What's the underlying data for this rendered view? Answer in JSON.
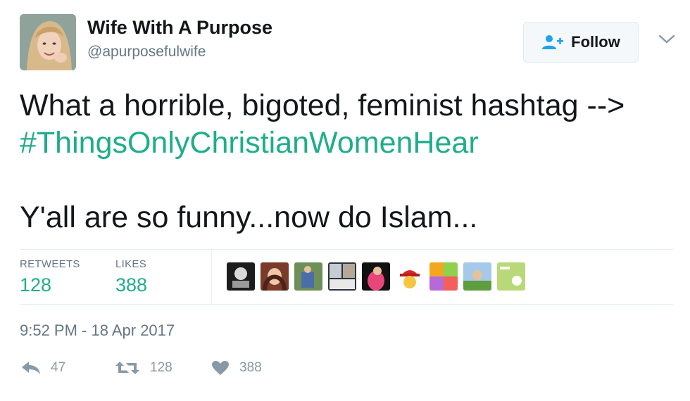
{
  "author": {
    "name": "Wife With A Purpose",
    "handle": "@apurposefulwife"
  },
  "follow_button": {
    "label": "Follow",
    "icon": "person-add-icon"
  },
  "tweet": {
    "line1": "What a horrible, bigoted, feminist hashtag -->",
    "hashtag": "#ThingsOnlyChristianWomenHear",
    "line3": "Y'all are so funny...now do Islam..."
  },
  "stats": {
    "retweets_label": "RETWEETS",
    "retweets_value": "128",
    "likes_label": "LIKES",
    "likes_value": "388"
  },
  "liker_avatars": [
    "liker-avatar-1",
    "liker-avatar-2",
    "liker-avatar-3",
    "liker-avatar-4",
    "liker-avatar-5",
    "liker-avatar-6",
    "liker-avatar-7",
    "liker-avatar-8",
    "liker-avatar-9"
  ],
  "timestamp": "9:52 PM - 18 Apr 2017",
  "actions": {
    "reply_count": "47",
    "retweet_count": "128",
    "like_count": "388"
  },
  "colors": {
    "accent": "#1fad8a",
    "text": "#14171a",
    "muted": "#657786",
    "icon": "#8899a6"
  }
}
